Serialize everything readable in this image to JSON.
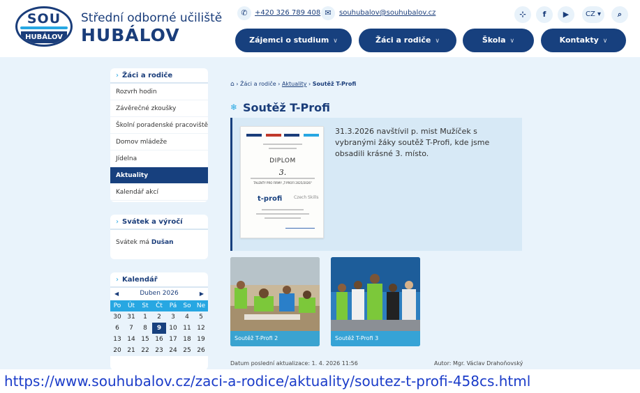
{
  "header": {
    "logo_top": "SOU",
    "logo_bottom": "HUBÁLOV",
    "school_line1": "Střední odborné učiliště",
    "school_line2": "HUBÁLOV",
    "phone": "+420 326 789 408",
    "email": "souhubalov@souhubalov.cz",
    "lang": "CZ ▾",
    "icons": [
      "phone-icon",
      "mail-icon",
      "sitemap-icon",
      "facebook-icon",
      "youtube-icon",
      "search-icon"
    ]
  },
  "nav": [
    {
      "label": "Zájemci o studium"
    },
    {
      "label": "Žáci a rodiče"
    },
    {
      "label": "Škola"
    },
    {
      "label": "Kontakty"
    }
  ],
  "sidebar": {
    "section_title": "Žáci a rodiče",
    "items": [
      {
        "label": "Rozvrh hodin"
      },
      {
        "label": "Závěrečné zkoušky"
      },
      {
        "label": "Školní poradenské pracoviště"
      },
      {
        "label": "Domov mládeže"
      },
      {
        "label": "Jídelna"
      },
      {
        "label": "Aktuality"
      },
      {
        "label": "Kalendář akcí"
      }
    ],
    "active_index": 5,
    "svatek_title": "Svátek a výročí",
    "svatek_prefix": "Svátek má",
    "svatek_name": "Dušan",
    "calendar_title": "Kalendář",
    "calendar_month": "Duben 2026",
    "calendar_days": [
      "Po",
      "Út",
      "St",
      "Čt",
      "Pá",
      "So",
      "Ne"
    ],
    "calendar_weeks": [
      [
        "30",
        "31",
        "1",
        "2",
        "3",
        "4",
        "5"
      ],
      [
        "6",
        "7",
        "8",
        "9",
        "10",
        "11",
        "12"
      ],
      [
        "13",
        "14",
        "15",
        "16",
        "17",
        "18",
        "19"
      ],
      [
        "20",
        "21",
        "22",
        "23",
        "24",
        "25",
        "26"
      ]
    ],
    "calendar_today": "9"
  },
  "main": {
    "breadcrumb": [
      "Žáci a rodiče",
      "Aktuality",
      "Soutěž T-Profi"
    ],
    "title": "Soutěž T-Profi",
    "article_text": "31.3.2026 navštívil p. mist Mužíček s vybranými žáky soutěž T-Profi, kde jsme obsadili krásné 3. místo.",
    "diploma": {
      "title": "DIPLOM",
      "place": "3.",
      "talent": "TALENTY PRO FIRMY „T-PROFI 2025/2026\"",
      "tprofi": "t-profi",
      "cs": "Czech Skills"
    },
    "thumbnails": [
      {
        "caption": "Soutěž T-Profi 2"
      },
      {
        "caption": "Soutěž T-Profi 3"
      }
    ],
    "last_update": "Datum poslední aktualizace: 1. 4. 2026 11:56",
    "author": "Autor: Mgr. Václav Drahoňovský"
  },
  "url_caption": "https://www.souhubalov.cz/zaci-a-rodice/aktuality/soutez-t-profi-458cs.html",
  "colors": {
    "navy": "#17407e",
    "accent": "#27a7e2",
    "band": "#e9f3fb"
  }
}
